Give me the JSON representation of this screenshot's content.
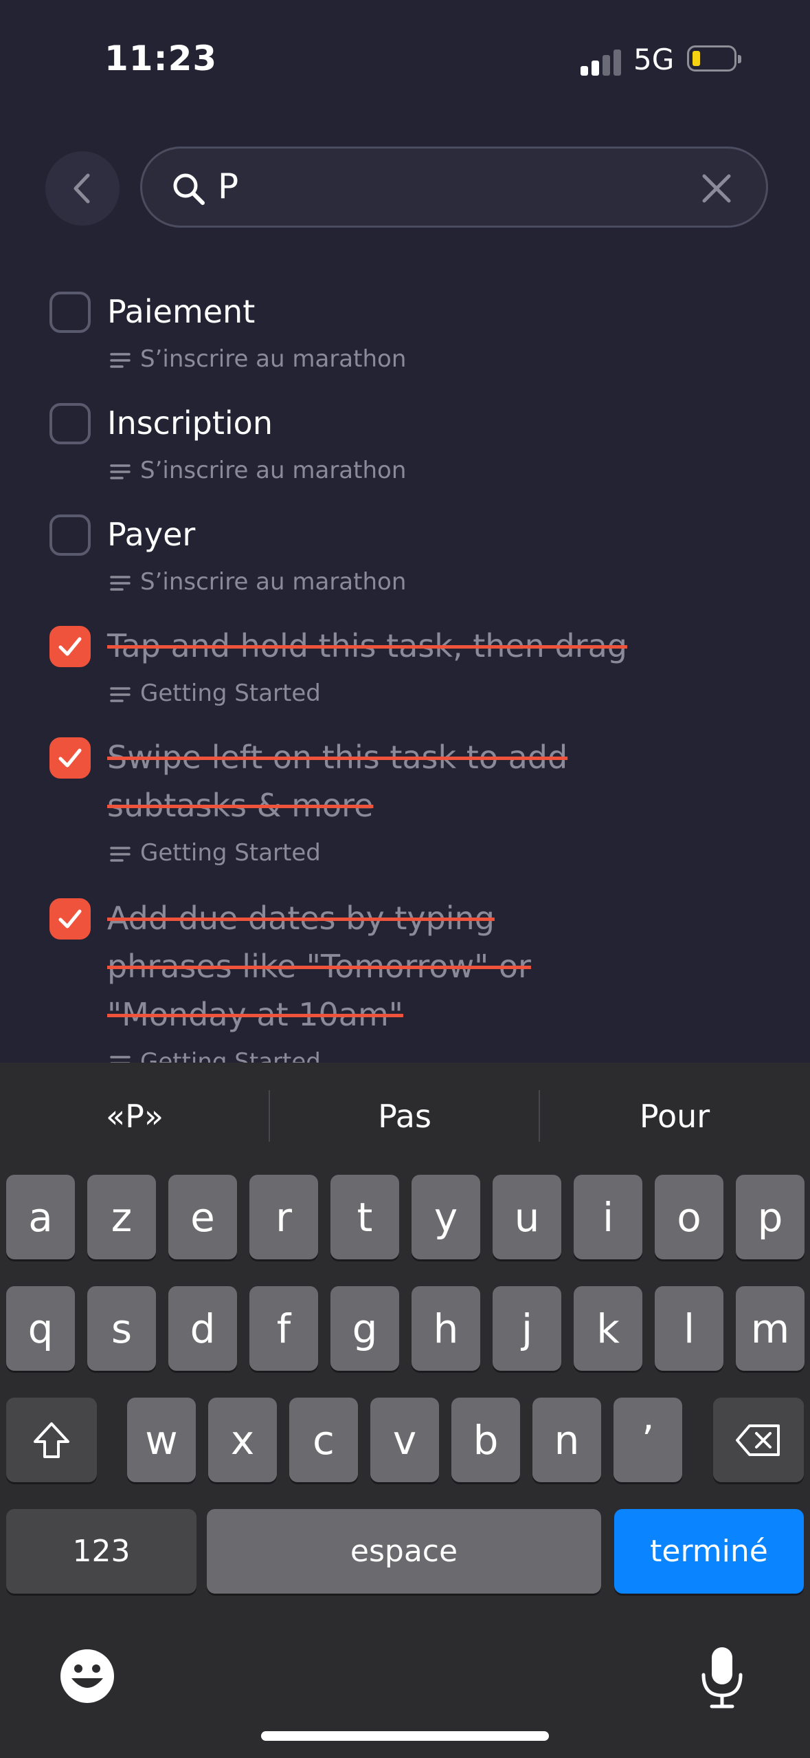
{
  "status_bar": {
    "time": "11:23",
    "network": "5G",
    "battery_color": "#f5d313"
  },
  "search": {
    "query": "P",
    "back_icon": "chevron-left-icon",
    "search_icon": "search-icon",
    "clear_icon": "close-icon"
  },
  "colors": {
    "accent": "#f0533c",
    "background": "#232333",
    "keyboard_blue": "#0a84ff"
  },
  "tasks": [
    {
      "title": "Paiement",
      "project": "S’inscrire au marathon",
      "done": false
    },
    {
      "title": "Inscription",
      "project": "S’inscrire au marathon",
      "done": false
    },
    {
      "title": "Payer",
      "project": "S’inscrire au marathon",
      "done": false
    },
    {
      "title": "Tap and hold this task, then drag",
      "project": "Getting Started",
      "done": true
    },
    {
      "title": "Swipe left on this task to add subtasks & more",
      "project": "Getting Started",
      "done": true
    },
    {
      "title": "Add due dates by typing phrases like \"Tomorrow\" or \"Monday at 10am\"",
      "project": "Getting Started",
      "done": true
    }
  ],
  "keyboard": {
    "suggestions": [
      "«P»",
      "Pas",
      "Pour"
    ],
    "row1": [
      "a",
      "z",
      "e",
      "r",
      "t",
      "y",
      "u",
      "i",
      "o",
      "p"
    ],
    "row2": [
      "q",
      "s",
      "d",
      "f",
      "g",
      "h",
      "j",
      "k",
      "l",
      "m"
    ],
    "row3": [
      "w",
      "x",
      "c",
      "v",
      "b",
      "n",
      "’"
    ],
    "numbers_label": "123",
    "space_label": "espace",
    "done_label": "terminé"
  }
}
